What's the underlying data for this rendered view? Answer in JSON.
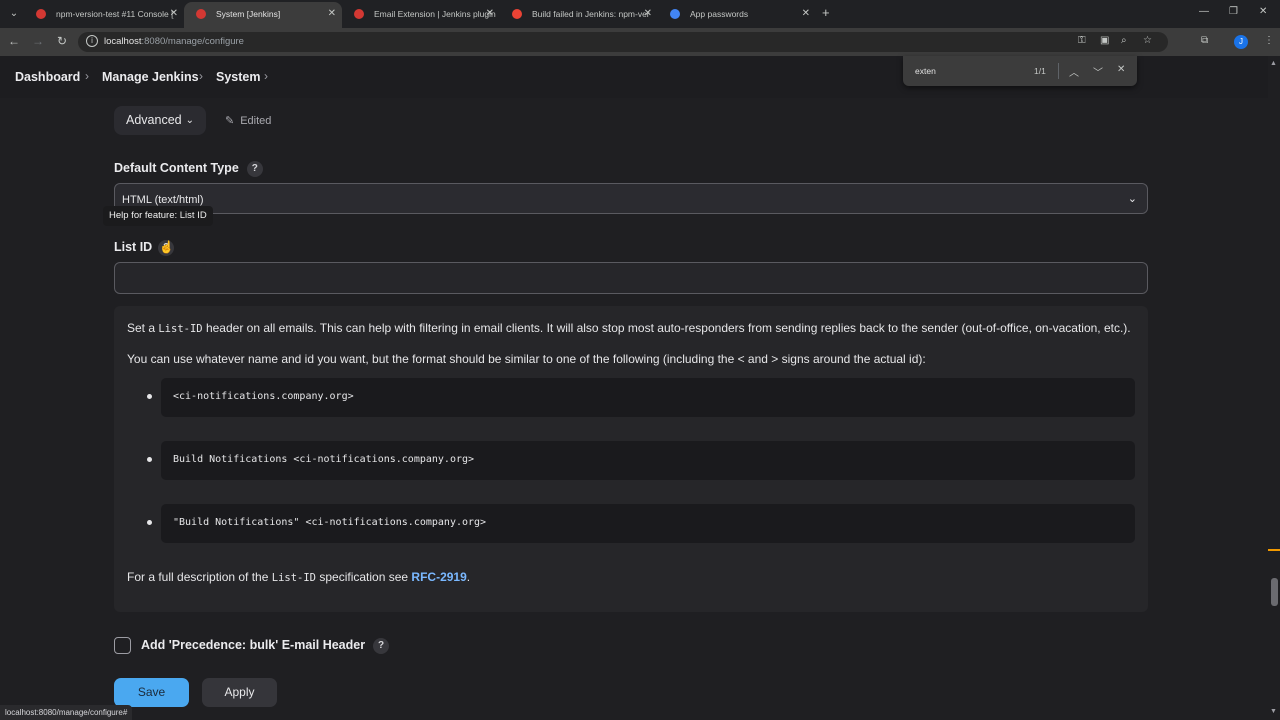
{
  "browser": {
    "tabs": [
      {
        "label": "npm-version-test #11 Console [",
        "active": false,
        "favicon_color": "#d33833"
      },
      {
        "label": "System [Jenkins]",
        "active": true,
        "favicon_color": "#d33833"
      },
      {
        "label": "Email Extension | Jenkins plugin",
        "active": false,
        "favicon_color": "#d33833"
      },
      {
        "label": "Build failed in Jenkins: npm-ver",
        "active": false,
        "favicon_color": "#ea4335"
      },
      {
        "label": "App passwords",
        "active": false,
        "favicon_color": "#4285f4"
      }
    ],
    "url_host": "localhost",
    "url_rest": ":8080/manage/configure",
    "profile_initial": "J"
  },
  "find": {
    "query": "exten",
    "count": "1/1"
  },
  "breadcrumb": {
    "items": [
      "Dashboard",
      "Manage Jenkins",
      "System"
    ]
  },
  "form": {
    "advanced_label": "Advanced",
    "edited_label": "Edited",
    "content_type_label": "Default Content Type",
    "content_type_value": "HTML (text/html)",
    "tooltip": "Help for feature: List ID",
    "list_id_label": "List ID",
    "list_id_value": "",
    "help": {
      "p1_pre": "Set a ",
      "p1_code": "List-ID",
      "p1_post": " header on all emails. This can help with filtering in email clients. It will also stop most auto-responders from sending replies back to the sender (out-of-office, on-vacation, etc.).",
      "p2": "You can use whatever name and id you want, but the format should be similar to one of the following (including the < and > signs around the actual id):",
      "examples": [
        "<ci-notifications.company.org>",
        "Build Notifications <ci-notifications.company.org>",
        "\"Build Notifications\" <ci-notifications.company.org>"
      ],
      "p3_pre": "For a full description of the ",
      "p3_code": "List-ID",
      "p3_mid": " specification see ",
      "p3_link": "RFC-2919",
      "p3_post": "."
    },
    "precedence_label": "Add 'Precedence: bulk' E-mail Header",
    "save_label": "Save",
    "apply_label": "Apply"
  },
  "status_url": "localhost:8080/manage/configure#"
}
